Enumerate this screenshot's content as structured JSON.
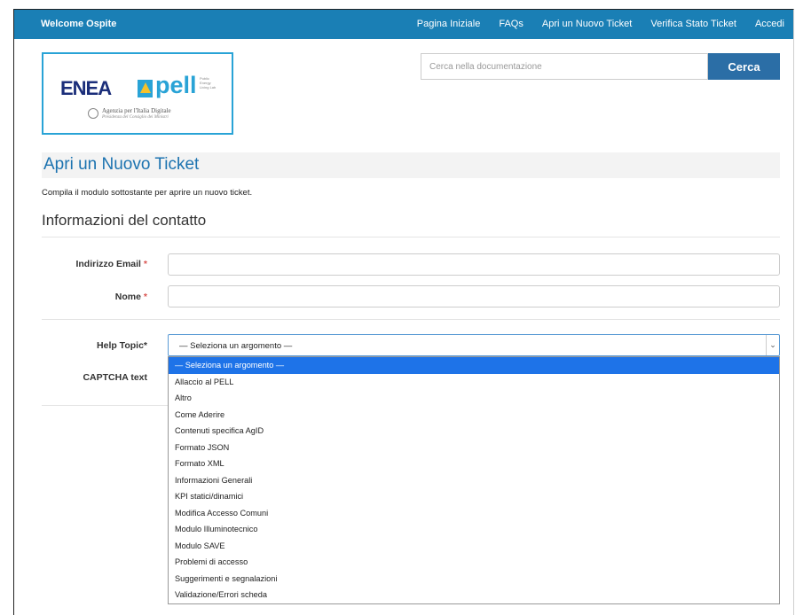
{
  "topbar": {
    "welcome": "Welcome Ospite",
    "nav": [
      "Pagina Iniziale",
      "FAQs",
      "Apri un Nuovo Ticket",
      "Verifica Stato Ticket",
      "Accedi"
    ]
  },
  "logo": {
    "enea": "ENEA",
    "pell": "pell",
    "pell_small": "Public Energy Living Lab",
    "agid_line1": "Agenzia per l'Italia Digitale",
    "agid_line2": "Presidenza del Consiglio dei Ministri"
  },
  "search": {
    "placeholder": "Cerca nella documentazione",
    "button": "Cerca"
  },
  "page": {
    "title": "Apri un Nuovo Ticket",
    "intro": "Compila il modulo sottostante per aprire un nuovo ticket.",
    "section": "Informazioni del contatto"
  },
  "form": {
    "email_label": "Indirizzo Email",
    "name_label": "Nome",
    "required_mark": "*",
    "help_topic_label": "Help Topic*",
    "captcha_label": "CAPTCHA text",
    "help_topic_value": "— Seleziona un argomento —"
  },
  "dropdown_options": [
    "— Seleziona un argomento —",
    "Allaccio al PELL",
    "Altro",
    "Come Aderire",
    "Contenuti specifica AgID",
    "Formato JSON",
    "Formato XML",
    "Informazioni Generali",
    "KPI statici/dinamici",
    "Modifica Accesso Comuni",
    "Modulo Illuminotecnico",
    "Modulo SAVE",
    "Problemi di accesso",
    "Suggerimenti e segnalazioni",
    "Validazione/Errori scheda"
  ],
  "colors": {
    "topbar": "#1a7fb5",
    "accent": "#2b6ea6",
    "selected_option": "#1e73e8"
  }
}
